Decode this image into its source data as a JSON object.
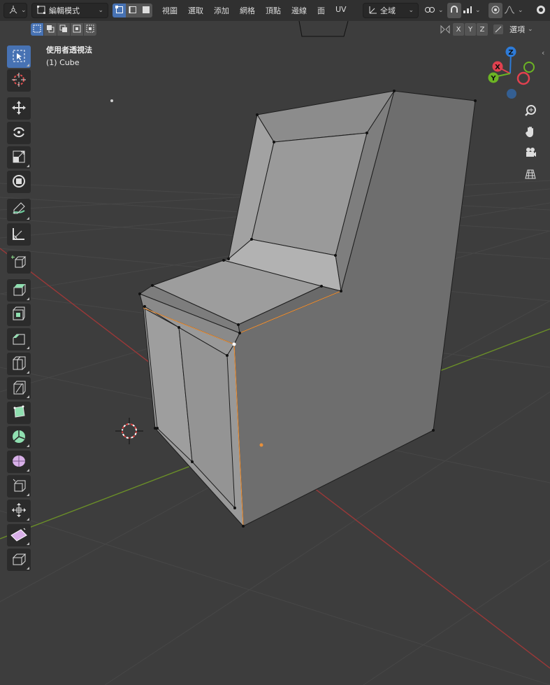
{
  "header": {
    "mode_label": "編輯模式",
    "menus": [
      "視圖",
      "選取",
      "添加",
      "網格",
      "頂點",
      "邊線",
      "面",
      "UV"
    ],
    "transform_orientation": "全域",
    "options_label": "選項"
  },
  "axes_buttons": [
    "X",
    "Y",
    "Z"
  ],
  "viewport": {
    "view_name": "使用者透視法",
    "object_label": "(1) Cube"
  },
  "gizmo": {
    "x": "X",
    "y": "Y",
    "z": "Z",
    "colors": {
      "x": "#e1414f",
      "y": "#6cb424",
      "z": "#2d7bd8"
    }
  },
  "toolbar": {
    "tools": [
      "select-box",
      "cursor",
      "move",
      "rotate",
      "scale",
      "transform",
      "annotate",
      "measure",
      "add-cube",
      "extrude-region",
      "inset-faces",
      "bevel",
      "loop-cut",
      "knife",
      "poly-build",
      "spin",
      "smooth",
      "edge-slide",
      "shrink-fatten",
      "shear"
    ],
    "active": "select-box"
  },
  "colors": {
    "accent": "#4772b3",
    "background": "#3d3d3d",
    "grid": "#474747",
    "x_axis": "#9b3838",
    "y_axis": "#6a8e28",
    "mesh_face": "#8a8a8a",
    "selected_edge": "#e8903a"
  }
}
